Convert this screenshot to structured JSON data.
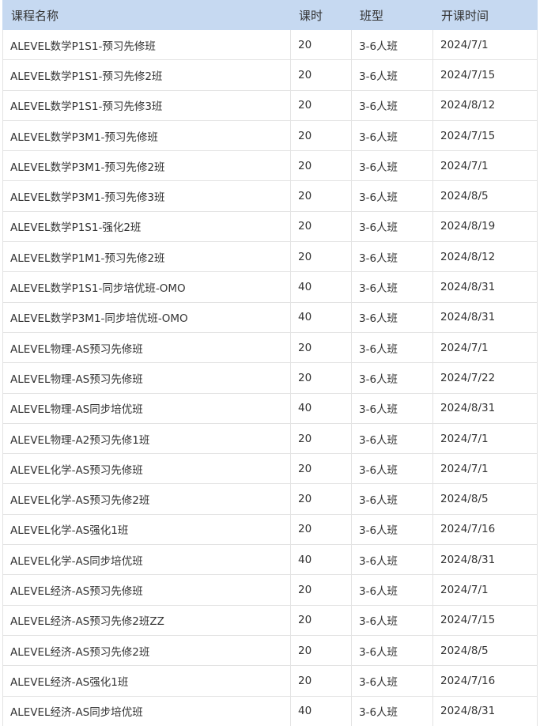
{
  "table": {
    "headers": [
      "课程名称",
      "课时",
      "班型",
      "开课时间"
    ],
    "rows": [
      [
        "ALEVEL数学P1S1-预习先修班",
        "20",
        "3-6人班",
        "2024/7/1"
      ],
      [
        "ALEVEL数学P1S1-预习先修2班",
        "20",
        "3-6人班",
        "2024/7/15"
      ],
      [
        "ALEVEL数学P1S1-预习先修3班",
        "20",
        "3-6人班",
        "2024/8/12"
      ],
      [
        "ALEVEL数学P3M1-预习先修班",
        "20",
        "3-6人班",
        "2024/7/15"
      ],
      [
        "ALEVEL数学P3M1-预习先修2班",
        "20",
        "3-6人班",
        "2024/7/1"
      ],
      [
        "ALEVEL数学P3M1-预习先修3班",
        "20",
        "3-6人班",
        "2024/8/5"
      ],
      [
        "ALEVEL数学P1S1-强化2班",
        "20",
        "3-6人班",
        "2024/8/19"
      ],
      [
        "ALEVEL数学P1M1-预习先修2班",
        "20",
        "3-6人班",
        "2024/8/12"
      ],
      [
        "ALEVEL数学P1S1-同步培优班-OMO",
        "40",
        "3-6人班",
        "2024/8/31"
      ],
      [
        "ALEVEL数学P3M1-同步培优班-OMO",
        "40",
        "3-6人班",
        "2024/8/31"
      ],
      [
        "ALEVEL物理-AS预习先修班",
        "20",
        "3-6人班",
        "2024/7/1"
      ],
      [
        "ALEVEL物理-AS预习先修班",
        "20",
        "3-6人班",
        "2024/7/22"
      ],
      [
        "ALEVEL物理-AS同步培优班",
        "40",
        "3-6人班",
        "2024/8/31"
      ],
      [
        "ALEVEL物理-A2预习先修1班",
        "20",
        "3-6人班",
        "2024/7/1"
      ],
      [
        "ALEVEL化学-AS预习先修班",
        "20",
        "3-6人班",
        "2024/7/1"
      ],
      [
        "ALEVEL化学-AS预习先修2班",
        "20",
        "3-6人班",
        "2024/8/5"
      ],
      [
        "ALEVEL化学-AS强化1班",
        "20",
        "3-6人班",
        "2024/7/16"
      ],
      [
        "ALEVEL化学-AS同步培优班",
        "40",
        "3-6人班",
        "2024/8/31"
      ],
      [
        "ALEVEL经济-AS预习先修班",
        "20",
        "3-6人班",
        "2024/7/1"
      ],
      [
        "ALEVEL经济-AS预习先修2班ZZ",
        "20",
        "3-6人班",
        "2024/7/15"
      ],
      [
        "ALEVEL经济-AS预习先修2班",
        "20",
        "3-6人班",
        "2024/8/5"
      ],
      [
        "ALEVEL经济-AS强化1班",
        "20",
        "3-6人班",
        "2024/7/16"
      ],
      [
        "ALEVEL经济-AS同步培优班",
        "40",
        "3-6人班",
        "2024/8/31"
      ]
    ]
  },
  "colors": {
    "header_bg": "#c6d9f1",
    "border": "#e3e3e3",
    "text": "#333333"
  }
}
